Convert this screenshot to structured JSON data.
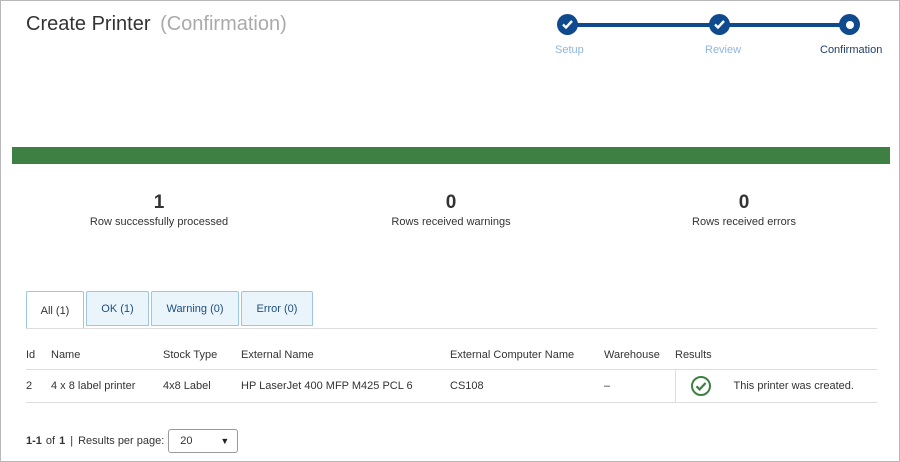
{
  "header": {
    "title": "Create Printer",
    "subtitle": "(Confirmation)"
  },
  "stepper": {
    "steps": [
      {
        "label": "Setup",
        "state": "complete"
      },
      {
        "label": "Review",
        "state": "complete"
      },
      {
        "label": "Confirmation",
        "state": "current"
      }
    ]
  },
  "progress": {
    "percent": 100,
    "color": "#3e8043"
  },
  "stats": [
    {
      "value": "1",
      "label": "Row successfully processed"
    },
    {
      "value": "0",
      "label": "Rows received warnings"
    },
    {
      "value": "0",
      "label": "Rows received errors"
    }
  ],
  "tabs": [
    {
      "label": "All (1)",
      "active": true
    },
    {
      "label": "OK (1)",
      "active": false
    },
    {
      "label": "Warning (0)",
      "active": false
    },
    {
      "label": "Error (0)",
      "active": false
    }
  ],
  "table": {
    "columns": [
      "Id",
      "Name",
      "Stock Type",
      "External Name",
      "External Computer Name",
      "Warehouse",
      "Results"
    ],
    "rows": [
      {
        "id": "2",
        "name": "4 x 8 label printer",
        "stock_type": "4x8 Label",
        "external_name": "HP LaserJet 400 MFP M425 PCL 6",
        "external_computer_name": "CS108",
        "warehouse": "–",
        "result_icon": "check-circle-icon",
        "result_text": "This printer was created."
      }
    ]
  },
  "pagination": {
    "range": "1-1",
    "of_label": "of",
    "total": "1",
    "separator": "|",
    "per_page_label": "Results per page:",
    "per_page_value": "20"
  },
  "colors": {
    "accent": "#0f4a8f",
    "success": "#3e8043"
  }
}
